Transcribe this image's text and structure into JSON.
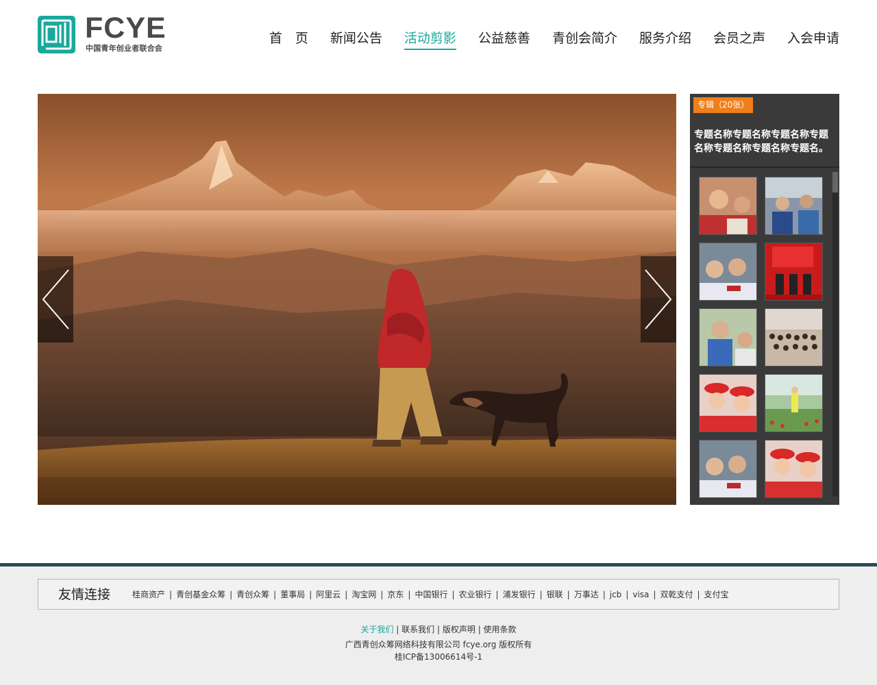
{
  "brand": {
    "name": "FCYE",
    "subtitle": "中国青年创业者联合会",
    "accent_color": "#1aa89c"
  },
  "nav": {
    "items": [
      {
        "label": "首　页",
        "active": false
      },
      {
        "label": "新闻公告",
        "active": false
      },
      {
        "label": "活动剪影",
        "active": true
      },
      {
        "label": "公益慈善",
        "active": false
      },
      {
        "label": "青创会简介",
        "active": false
      },
      {
        "label": "服务介绍",
        "active": false
      },
      {
        "label": "会员之声",
        "active": false
      },
      {
        "label": "入会申请",
        "active": false
      }
    ]
  },
  "gallery": {
    "main_photo": "photo-mountains-person-dog",
    "prev_icon": "chevron-left-icon",
    "next_icon": "chevron-right-icon"
  },
  "album": {
    "tag": "专辑（20张）",
    "title": "专题名称专题名称专题名称专题名称专题名称专题名称专题名。",
    "tag_color": "#ee7f1a",
    "thumbnails": [
      "thumb-children-smiling",
      "thumb-donation-event",
      "thumb-schoolgirls",
      "thumb-award-ceremony",
      "thumb-student-with-gift",
      "thumb-group-photo",
      "thumb-red-caps-girls",
      "thumb-field-outdoor",
      "thumb-schoolgirls-2",
      "thumb-red-caps-girls-2"
    ]
  },
  "footer": {
    "links_title": "友情连接",
    "links": [
      "桂商资产",
      "青创基金众筹",
      "青创众筹",
      "董事局",
      "阿里云",
      "淘宝网",
      "京东",
      "中国银行",
      "农业银行",
      "浦发银行",
      "银联",
      "万事达",
      "jcb",
      "visa",
      "双乾支付",
      "支付宝"
    ],
    "bottom_links": [
      "关于我们",
      "联系我们",
      "版权声明",
      "使用条款"
    ],
    "copyright": "广西青创众筹网络科技有限公司 fcye.org 版权所有",
    "icp": "桂ICP备13006614号-1",
    "border_color": "#2e4a55"
  }
}
